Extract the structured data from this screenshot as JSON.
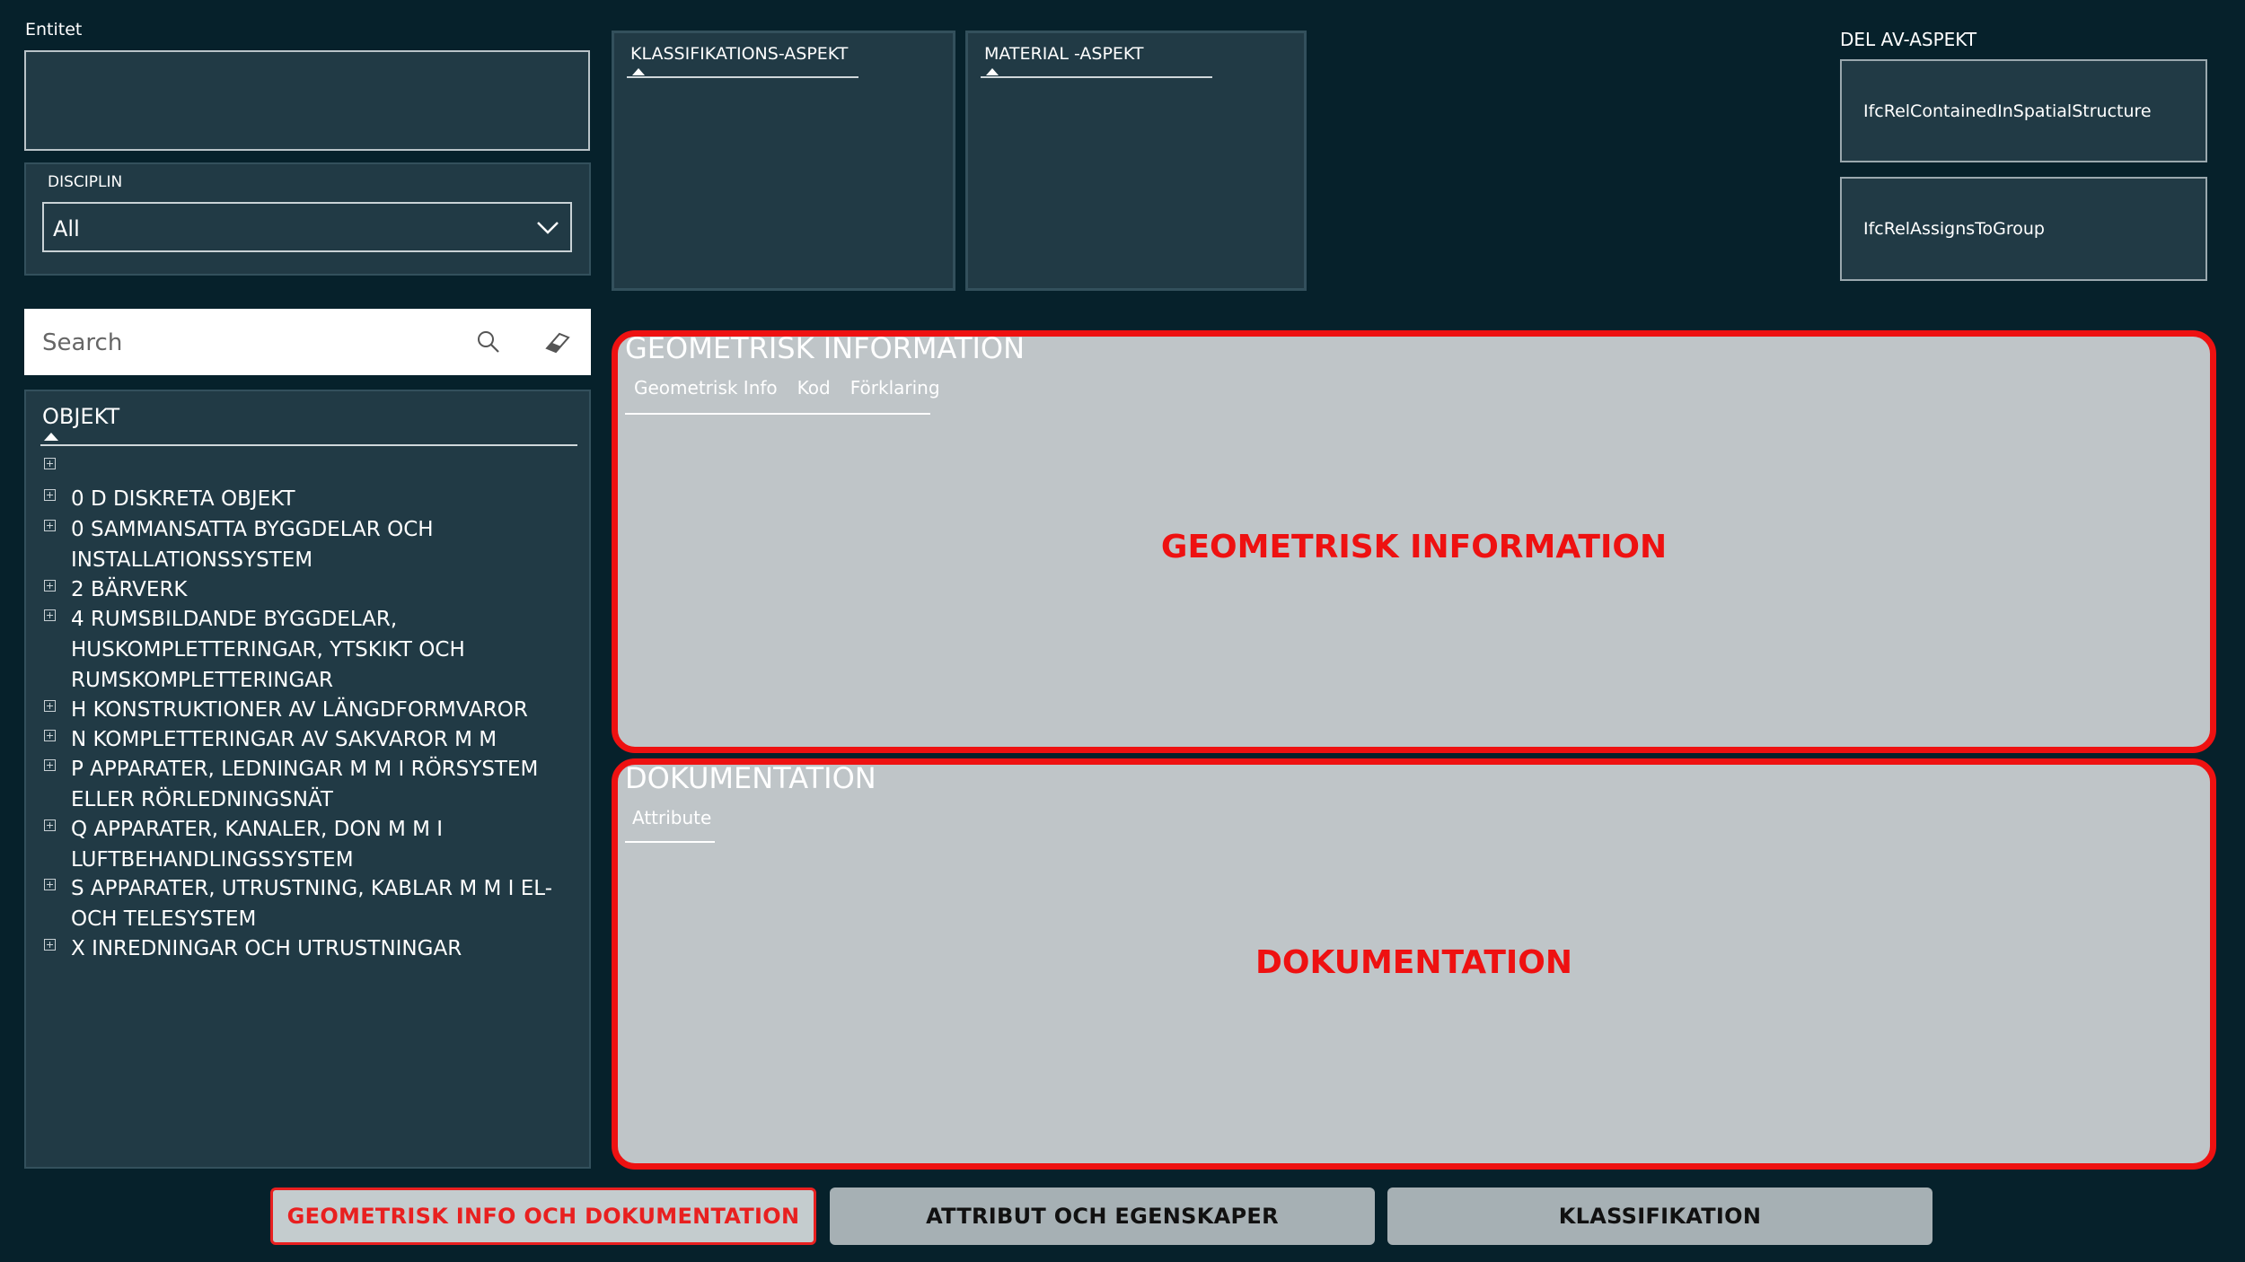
{
  "entitet": {
    "label": "Entitet"
  },
  "disciplin": {
    "label": "DISCIPLIN",
    "selected": "All"
  },
  "search": {
    "placeholder": "Search"
  },
  "objekt": {
    "header": "OBJEKT",
    "items": [
      "",
      "0 D DISKRETA OBJEKT",
      "0 SAMMANSATTA BYGGDELAR OCH INSTALLATIONSSYSTEM",
      "2 BÄRVERK",
      "4 RUMSBILDANDE BYGGDELAR, HUSKOMPLETTERINGAR, YTSKIKT OCH RUMSKOMPLETTERINGAR",
      "H KONSTRUKTIONER AV LÄNGDFORMVAROR",
      "N KOMPLETTERINGAR AV SAKVAROR M M",
      "P APPARATER, LEDNINGAR M M I RÖRSYSTEM ELLER RÖRLEDNINGSNÄT",
      "Q APPARATER, KANALER, DON M M I LUFTBEHANDLINGSSYSTEM",
      "S APPARATER, UTRUSTNING, KABLAR M M I EL- OCH TELESYSTEM",
      "X INREDNINGAR OCH UTRUSTNINGAR"
    ]
  },
  "aspects": {
    "klassifikation": "KLASSIFIKATIONS-ASPEKT",
    "material": "MATERIAL -ASPEKT"
  },
  "delav": {
    "label": "DEL AV-ASPEKT",
    "buttons": [
      "IfcRelContainedInSpatialStructure",
      "IfcRelAssignsToGroup"
    ]
  },
  "geometrisk": {
    "title": "GEOMETRISK INFORMATION",
    "tabs": [
      "Geometrisk Info",
      "Kod",
      "Förklaring"
    ],
    "overlay": "GEOMETRISK INFORMATION"
  },
  "dokumentation": {
    "title": "DOKUMENTATION",
    "tabs": [
      "Attribute"
    ],
    "overlay": "DOKUMENTATION"
  },
  "nav": {
    "geo": "GEOMETRISK INFO OCH DOKUMENTATION",
    "attr": "ATTRIBUT OCH EGENSKAPER",
    "klass": "KLASSIFIKATION"
  },
  "colors": {
    "background": "#06212b",
    "panel": "#213a45",
    "highlight": "#ee1111",
    "content": "#bfc5c8"
  }
}
